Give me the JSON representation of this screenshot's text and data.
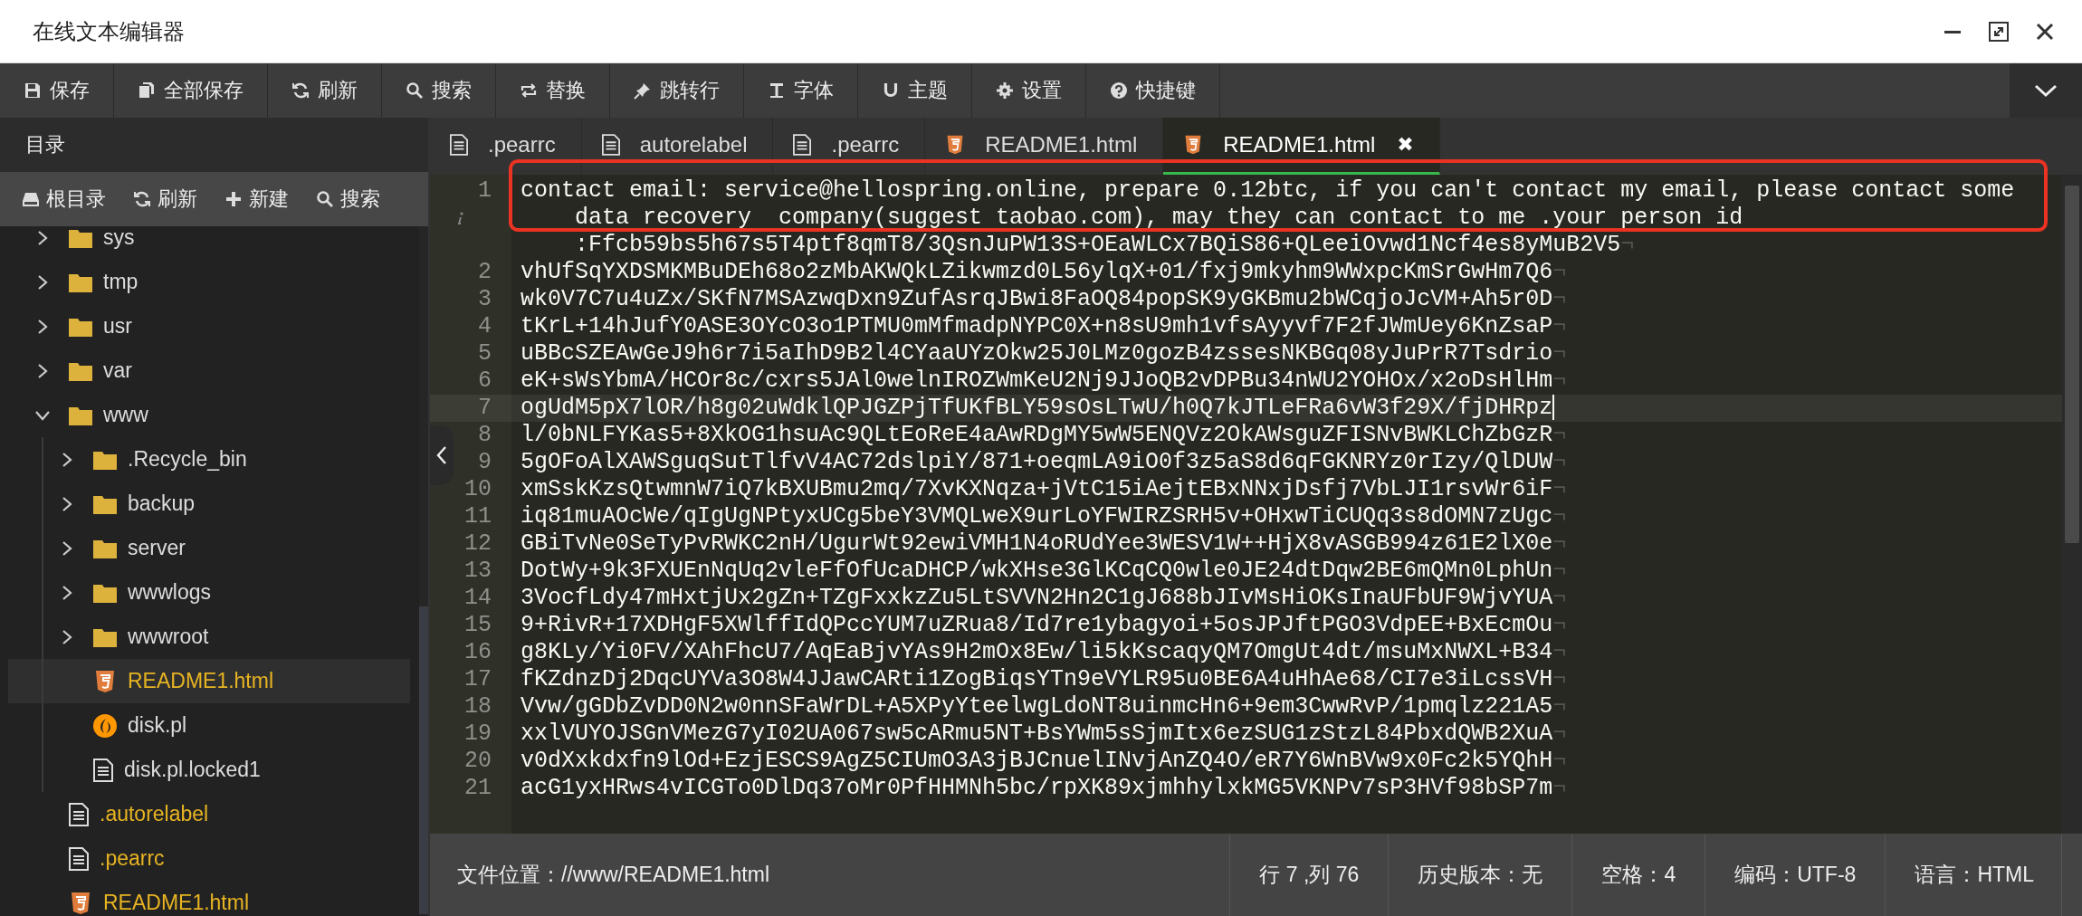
{
  "window": {
    "title": "在线文本编辑器"
  },
  "toolbar": [
    {
      "label": "保存",
      "kind": "save"
    },
    {
      "label": "全部保存",
      "kind": "saveall"
    },
    {
      "label": "刷新",
      "kind": "refresh"
    },
    {
      "label": "搜索",
      "kind": "search"
    },
    {
      "label": "替换",
      "kind": "replace"
    },
    {
      "label": "跳转行",
      "kind": "goto"
    },
    {
      "label": "字体",
      "kind": "font"
    },
    {
      "label": "主题",
      "kind": "theme"
    },
    {
      "label": "设置",
      "kind": "settings"
    },
    {
      "label": "快捷键",
      "kind": "help"
    }
  ],
  "sidebar": {
    "title": "目录",
    "actions": [
      {
        "label": "根目录",
        "kind": "drive"
      },
      {
        "label": "刷新",
        "kind": "refresh"
      },
      {
        "label": "新建",
        "kind": "add"
      },
      {
        "label": "搜索",
        "kind": "search"
      }
    ],
    "tree": [
      {
        "label": "sys",
        "kind": "folder",
        "expanded": false,
        "selected": false,
        "open": false
      },
      {
        "label": "tmp",
        "kind": "folder",
        "expanded": false,
        "selected": false,
        "open": false
      },
      {
        "label": "usr",
        "kind": "folder",
        "expanded": false,
        "selected": false,
        "open": false
      },
      {
        "label": "var",
        "kind": "folder",
        "expanded": false,
        "selected": false,
        "open": false
      },
      {
        "label": "www",
        "kind": "folder",
        "expanded": true,
        "selected": false,
        "open": false,
        "children": [
          {
            "label": ".Recycle_bin",
            "kind": "folder",
            "expanded": false,
            "selected": false,
            "open": false
          },
          {
            "label": "backup",
            "kind": "folder",
            "expanded": false,
            "selected": false,
            "open": false
          },
          {
            "label": "server",
            "kind": "folder",
            "expanded": false,
            "selected": false,
            "open": false
          },
          {
            "label": "wwwlogs",
            "kind": "folder",
            "expanded": false,
            "selected": false,
            "open": false
          },
          {
            "label": "wwwroot",
            "kind": "folder",
            "expanded": false,
            "selected": false,
            "open": false
          },
          {
            "label": "README1.html",
            "kind": "html",
            "selected": true,
            "open": true
          },
          {
            "label": "disk.pl",
            "kind": "perl",
            "selected": false,
            "open": false
          },
          {
            "label": "disk.pl.locked1",
            "kind": "file",
            "selected": false,
            "open": false
          }
        ]
      },
      {
        "label": ".autorelabel",
        "kind": "file",
        "selected": false,
        "open": true
      },
      {
        "label": ".pearrc",
        "kind": "file",
        "selected": false,
        "open": true
      },
      {
        "label": "README1.html",
        "kind": "html",
        "selected": false,
        "open": true
      }
    ]
  },
  "tabs": [
    {
      "label": ".pearrc",
      "kind": "file",
      "selected": false
    },
    {
      "label": "autorelabel",
      "kind": "file",
      "selected": false
    },
    {
      "label": ".pearrc",
      "kind": "file",
      "selected": false
    },
    {
      "label": "README1.html",
      "kind": "html",
      "selected": false
    },
    {
      "label": "README1.html",
      "kind": "html",
      "selected": true,
      "close": "✖"
    }
  ],
  "editor": {
    "lines": [
      {
        "number": "1",
        "info": true,
        "highlighted": true,
        "active": false,
        "rows": [
          "contact email: service@hellospring.online, prepare 0.12btc, if you can't contact my email, please contact some",
          "data recovery  company(suggest taobao.com), may they can contact to me .your person id",
          ":Ffcb59bs5h67s5T4ptf8qmT8/3QsnJuPW13S+OEaWLCx7BQiS86+QLeeiOvwd1Ncf4es8yMuB2V5"
        ],
        "eol": "¬"
      },
      {
        "number": "2",
        "info": false,
        "highlighted": false,
        "active": false,
        "rows": [
          "vhUfSqYXDSMKMBuDEh68o2zMbAKWQkLZikwmzd0L56ylqX+01/fxj9mkyhm9WWxpcKmSrGwHm7Q6"
        ],
        "eol": "¬"
      },
      {
        "number": "3",
        "info": false,
        "highlighted": false,
        "active": false,
        "rows": [
          "wk0V7C7u4uZx/SKfN7MSAzwqDxn9ZufAsrqJBwi8FaOQ84popSK9yGKBmu2bWCqjoJcVM+Ah5r0D"
        ],
        "eol": "¬"
      },
      {
        "number": "4",
        "info": false,
        "highlighted": false,
        "active": false,
        "rows": [
          "tKrL+14hJufY0ASE3OYcO3o1PTMU0mMfmadpNYPC0X+n8sU9mh1vfsAyyvf7F2fJWmUey6KnZsaP"
        ],
        "eol": "¬"
      },
      {
        "number": "5",
        "info": false,
        "highlighted": false,
        "active": false,
        "rows": [
          "uBBcSZEAwGeJ9h6r7i5aIhD9B2l4CYaaUYzOkw25J0LMz0gozB4zssesNKBGq08yJuPrR7Tsdrio"
        ],
        "eol": "¬"
      },
      {
        "number": "6",
        "info": false,
        "highlighted": false,
        "active": false,
        "rows": [
          "eK+sWsYbmA/HCOr8c/cxrs5JAl0welnIROZWmKeU2Nj9JJoQB2vDPBu34nWU2YOHOx/x2oDsHlHm"
        ],
        "eol": "¬"
      },
      {
        "number": "7",
        "info": false,
        "highlighted": false,
        "active": true,
        "rows": [
          "ogUdM5pX7lOR/h8g02uWdklQPJGZPjTfUKfBLY59sOsLTwU/h0Q7kJTLeFRa6vW3f29X/fjDHRpz"
        ]
      },
      {
        "number": "8",
        "info": false,
        "highlighted": false,
        "active": false,
        "rows": [
          "l/0bNLFYKas5+8XkOG1hsuAc9QLtEoReE4aAwRDgMY5wW5ENQVz2OkAWsguZFISNvBWKLChZbGzR"
        ],
        "eol": "¬"
      },
      {
        "number": "9",
        "info": false,
        "highlighted": false,
        "active": false,
        "rows": [
          "5gOFoAlXAWSguqSutTlfvV4AC72dslpiY/871+oeqmLA9iO0f3z5aS8d6qFGKNRYz0rIzy/QlDUW"
        ],
        "eol": "¬"
      },
      {
        "number": "10",
        "info": false,
        "highlighted": false,
        "active": false,
        "rows": [
          "xmSskKzsQtwmnW7iQ7kBXUBmu2mq/7XvKXNqza+jVtC15iAejtEBxNNxjDsfj7VbLJI1rsvWr6iF"
        ],
        "eol": "¬"
      },
      {
        "number": "11",
        "info": false,
        "highlighted": false,
        "active": false,
        "rows": [
          "iq81muAOcWe/qIgUgNPtyxUCg5beY3VMQLweX9urLoYFWIRZSRH5v+OHxwTiCUQq3s8dOMN7zUgc"
        ],
        "eol": "¬"
      },
      {
        "number": "12",
        "info": false,
        "highlighted": false,
        "active": false,
        "rows": [
          "GBiTvNe0SeTyPvRWKC2nH/UgurWt92ewiVMH1N4oRUdYee3WESV1W++HjX8vASGB994z61E2lX0e"
        ],
        "eol": "¬"
      },
      {
        "number": "13",
        "info": false,
        "highlighted": false,
        "active": false,
        "rows": [
          "DotWy+9k3FXUEnNqUq2vleFfOfUcaDHCP/wkXHse3GlKCqCQ0wle0JE24dtDqw2BE6mQMn0LphUn"
        ],
        "eol": "¬"
      },
      {
        "number": "14",
        "info": false,
        "highlighted": false,
        "active": false,
        "rows": [
          "3VocfLdy47mHxtjUx2gZn+TZgFxxkzZu5LtSVVN2Hn2C1gJ688bJIvMsHiOKsInaUFbUF9WjvYUA"
        ],
        "eol": "¬"
      },
      {
        "number": "15",
        "info": false,
        "highlighted": false,
        "active": false,
        "rows": [
          "9+RivR+17XDHgF5XWlffIdQPccYUM7uZRua8/Id7re1ybagyoi+5osJPJftPGO3VdpEE+BxEcmOu"
        ],
        "eol": "¬"
      },
      {
        "number": "16",
        "info": false,
        "highlighted": false,
        "active": false,
        "rows": [
          "g8KLy/Yi0FV/XAhFhcU7/AqEaBjvYAs9H2mOx8Ew/li5kKscaqyQM7OmgUt4dt/msuMxNWXL+B34"
        ],
        "eol": "¬"
      },
      {
        "number": "17",
        "info": false,
        "highlighted": false,
        "active": false,
        "rows": [
          "fKZdnzDj2DqcUYVa3O8W4JJawCARti1ZogBiqsYTn9eVYLR95u0BE6A4uHhAe68/CI7e3iLcssVH"
        ],
        "eol": "¬"
      },
      {
        "number": "18",
        "info": false,
        "highlighted": false,
        "active": false,
        "rows": [
          "Vvw/gGDbZvDD0N2w0nnSFaWrDL+A5XPyYteelwgLdoNT8uinmcHn6+9em3CwwRvP/1pmqlz221A5"
        ],
        "eol": "¬"
      },
      {
        "number": "19",
        "info": false,
        "highlighted": false,
        "active": false,
        "rows": [
          "xxlVUYOJSGnVMezG7yI02UA067sw5cARmu5NT+BsYWm5sSjmItx6ezSUG1zStzL84PbxdQWB2XuA"
        ],
        "eol": "¬"
      },
      {
        "number": "20",
        "info": false,
        "highlighted": false,
        "active": false,
        "rows": [
          "v0dXxkdxfn9lOd+EzjESCS9AgZ5CIUmO3A3jBJCnuelINvjAnZQ4O/eR7Y6WnBVw9x0Fc2k5YQhH"
        ],
        "eol": "¬"
      },
      {
        "number": "21",
        "info": false,
        "highlighted": false,
        "active": false,
        "rows": [
          "acG1yxHRws4vICGTo0DlDq37oMr0PfHHMNh5bc/rpXK89xjmhhylxkMG5VKNPv7sP3HVf98bSP7m"
        ],
        "eol": "¬"
      }
    ]
  },
  "status_bar": {
    "path": "文件位置：//www/README1.html",
    "items": [
      "行 7 ,列 76",
      "历史版本：无",
      "空格：4",
      "编码：UTF-8",
      "语言：HTML"
    ]
  }
}
